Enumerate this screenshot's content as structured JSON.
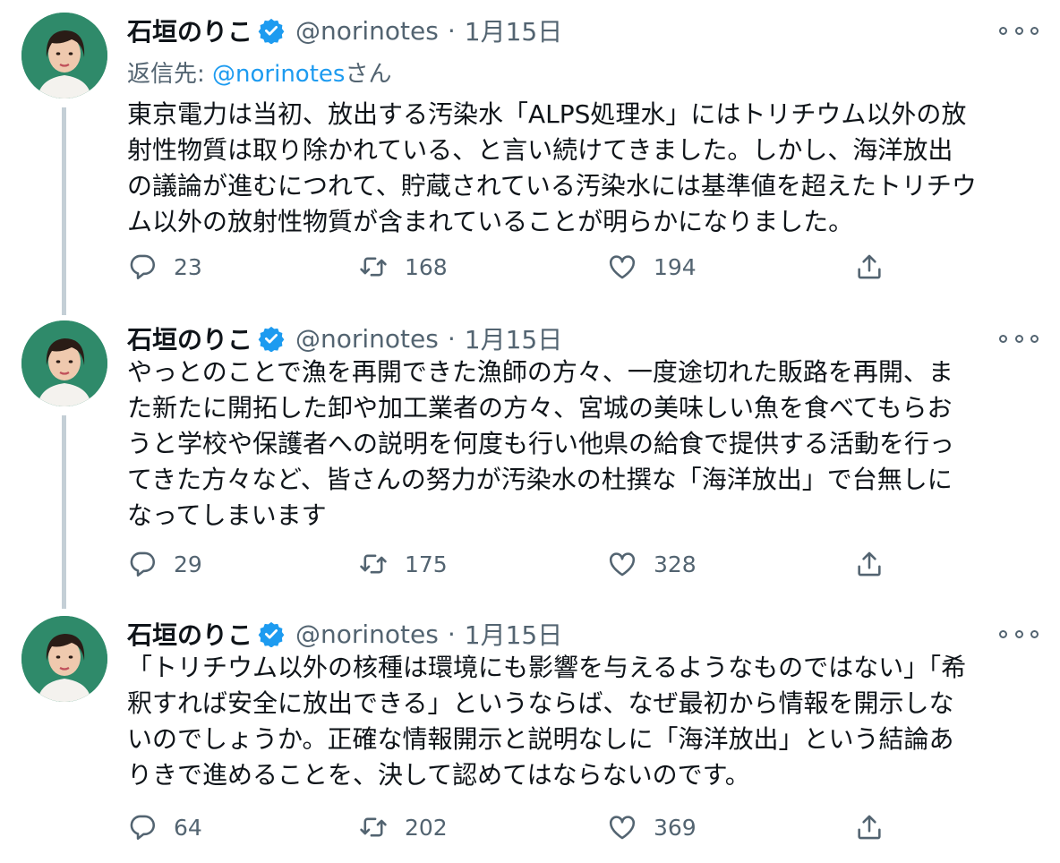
{
  "tweets": [
    {
      "name": "石垣のりこ",
      "handle": "@norinotes",
      "separator": "·",
      "date": "1月15日",
      "replying_to": {
        "label": "返信先: ",
        "mention": "@norinotes",
        "suffix": "さん"
      },
      "lines": [
        "東京電力は当初、放出する汚染水「ALPS処理水」にはトリチウム以外の放",
        "射性物質は取り除かれている、と言い続けてきました。しかし、海洋放出",
        "の議論が進むにつれて、貯蔵されている汚染水には基準値を超えたトリチウ",
        "ム以外の放射性物質が含まれていることが明らかになりました。"
      ],
      "replies": "23",
      "retweets": "168",
      "likes": "194"
    },
    {
      "name": "石垣のりこ",
      "handle": "@norinotes",
      "separator": "·",
      "date": "1月15日",
      "lines": [
        "やっとのことで漁を再開できた漁師の方々、一度途切れた販路を再開、ま",
        "た新たに開拓した卸や加工業者の方々、宮城の美味しい魚を食べてもらお",
        "うと学校や保護者への説明を何度も行い他県の給食で提供する活動を行っ",
        "てきた方々など、皆さんの努力が汚染水の杜撰な「海洋放出」で台無しに",
        "なってしまいます"
      ],
      "replies": "29",
      "retweets": "175",
      "likes": "328"
    },
    {
      "name": "石垣のりこ",
      "handle": "@norinotes",
      "separator": "·",
      "date": "1月15日",
      "lines": [
        "「トリチウム以外の核種は環境にも影響を与えるようなものではない」「希",
        "釈すれば安全に放出できる」というならば、なぜ最初から情報を開示しな",
        "いのでしょうか。正確な情報開示と説明なしに「海洋放出」という結論あ",
        "りきで進めることを、決して認めてはならないのです。"
      ],
      "replies": "64",
      "retweets": "202",
      "likes": "369"
    }
  ],
  "colors": {
    "text": "#0f1419",
    "secondary": "#536471",
    "accent": "#1d9bf0",
    "thread_line": "#c4cfd6",
    "avatar_bg": "#2f8a6a"
  },
  "icons": {
    "verified": "verified-badge-icon",
    "more": "more-options-icon",
    "reply": "reply-icon",
    "retweet": "retweet-icon",
    "like": "like-heart-icon",
    "share": "share-icon"
  }
}
